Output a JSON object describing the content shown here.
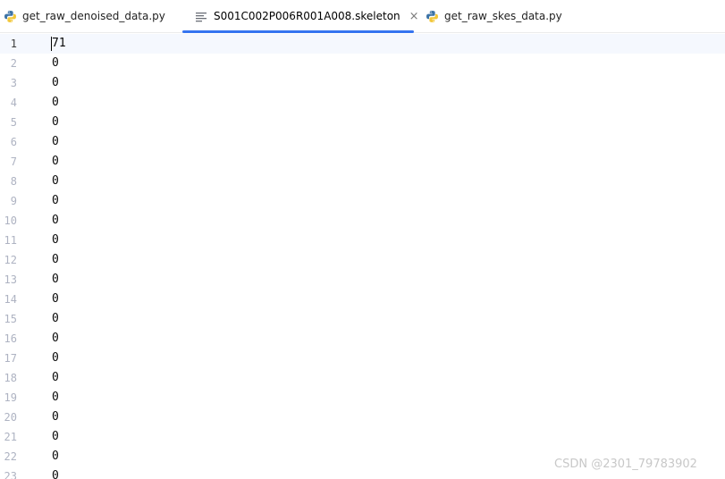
{
  "tabs": [
    {
      "label": "get_raw_denoised_data.py",
      "icon": "python-file-icon",
      "active": false
    },
    {
      "label": "S001C002P006R001A008.skeleton",
      "icon": "text-file-icon",
      "active": true,
      "close": "×"
    },
    {
      "label": "get_raw_skes_data.py",
      "icon": "python-file-icon",
      "active": false
    }
  ],
  "colors": {
    "accent": "#3574f0",
    "python_blue": "#3d73a6",
    "python_yellow": "#f2c73a",
    "current_line": "#f5f8fe",
    "line_number": "#aeb3c2"
  },
  "editor": {
    "lines": [
      {
        "number": "1",
        "text": "71"
      },
      {
        "number": "2",
        "text": "0"
      },
      {
        "number": "3",
        "text": "0"
      },
      {
        "number": "4",
        "text": "0"
      },
      {
        "number": "5",
        "text": "0"
      },
      {
        "number": "6",
        "text": "0"
      },
      {
        "number": "7",
        "text": "0"
      },
      {
        "number": "8",
        "text": "0"
      },
      {
        "number": "9",
        "text": "0"
      },
      {
        "number": "10",
        "text": "0"
      },
      {
        "number": "11",
        "text": "0"
      },
      {
        "number": "12",
        "text": "0"
      },
      {
        "number": "13",
        "text": "0"
      },
      {
        "number": "14",
        "text": "0"
      },
      {
        "number": "15",
        "text": "0"
      },
      {
        "number": "16",
        "text": "0"
      },
      {
        "number": "17",
        "text": "0"
      },
      {
        "number": "18",
        "text": "0"
      },
      {
        "number": "19",
        "text": "0"
      },
      {
        "number": "20",
        "text": "0"
      },
      {
        "number": "21",
        "text": "0"
      },
      {
        "number": "22",
        "text": "0"
      },
      {
        "number": "23",
        "text": "0"
      }
    ]
  },
  "watermark": "CSDN @2301_79783902"
}
